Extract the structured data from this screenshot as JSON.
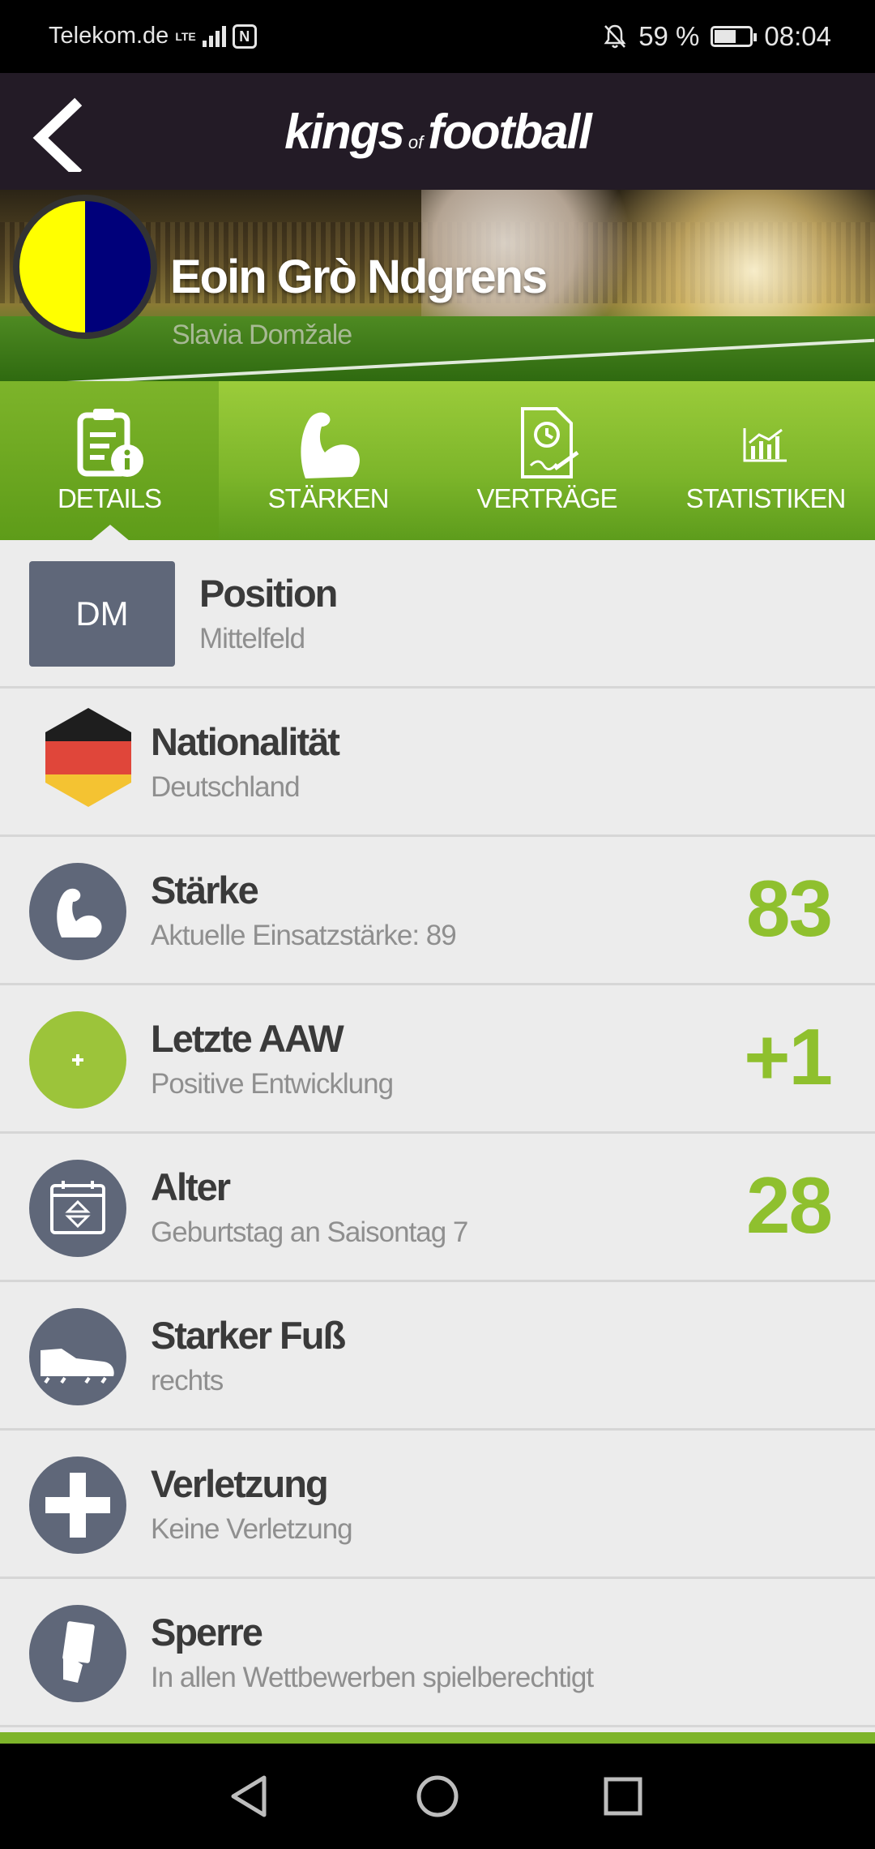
{
  "status_bar": {
    "carrier": "Telekom.de",
    "network": "LTE",
    "battery_percent": "59 %",
    "time": "08:04"
  },
  "header": {
    "logo_kings": "kings",
    "logo_of": "of",
    "logo_football": "football"
  },
  "player": {
    "name": "Eoin Grò Ndgrens",
    "club": "Slavia Domžale",
    "club_colors": [
      "#ffff00",
      "#00007a"
    ]
  },
  "tabs": [
    {
      "label": "DETAILS",
      "icon": "details-icon",
      "active": true
    },
    {
      "label": "STÄRKEN",
      "icon": "muscle-icon",
      "active": false
    },
    {
      "label": "VERTRÄGE",
      "icon": "contract-icon",
      "active": false
    },
    {
      "label": "STATISTIKEN",
      "icon": "stats-icon",
      "active": false
    }
  ],
  "details": {
    "position": {
      "badge": "DM",
      "title": "Position",
      "value": "Mittelfeld"
    },
    "nationality": {
      "title": "Nationalität",
      "value": "Deutschland",
      "icon": "germany-flag-icon"
    },
    "strength": {
      "title": "Stärke",
      "value": "Aktuelle Einsatzstärke: 89",
      "number": "83",
      "icon": "muscle-icon"
    },
    "last_aaw": {
      "title": "Letzte AAW",
      "value": "Positive Entwicklung",
      "number": "+1",
      "icon_text": "+"
    },
    "age": {
      "title": "Alter",
      "value": "Geburtstag an Saisontag 7",
      "number": "28",
      "icon": "calendar-icon"
    },
    "foot": {
      "title": "Starker Fuß",
      "value": "rechts",
      "icon": "boot-icon"
    },
    "injury": {
      "title": "Verletzung",
      "value": "Keine Verletzung",
      "icon": "cross-icon"
    },
    "suspension": {
      "title": "Sperre",
      "value": "In allen Wettbewerben spielberechtigt",
      "icon": "card-icon"
    }
  },
  "colors": {
    "accent_green": "#8fc02e",
    "icon_slate": "#5f6779",
    "header_dark": "#231b26"
  }
}
